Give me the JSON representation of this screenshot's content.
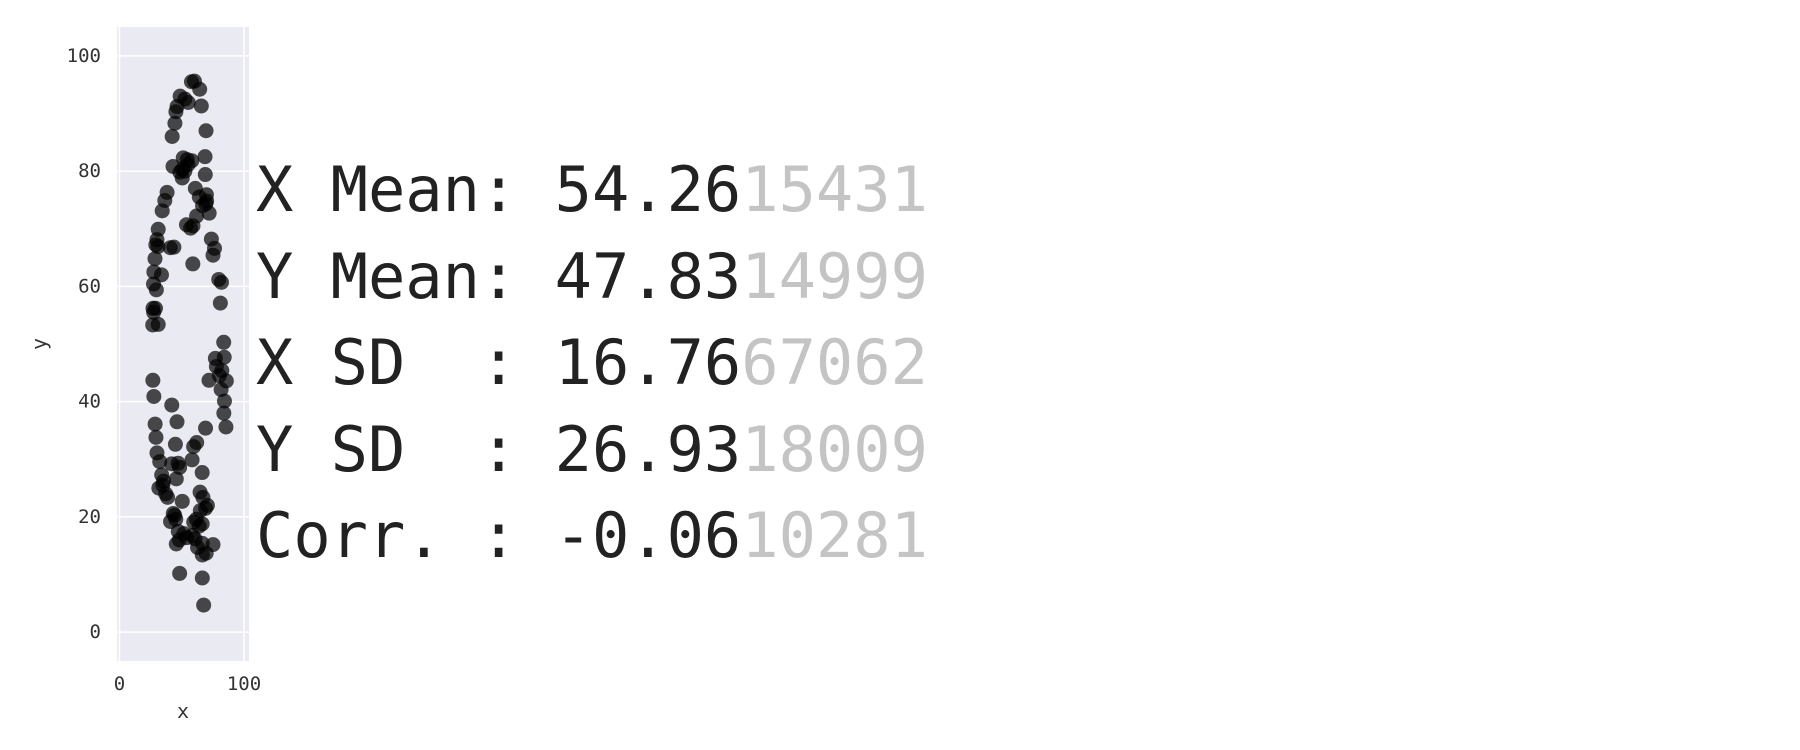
{
  "chart_data": {
    "type": "scatter",
    "xlabel": "x",
    "ylabel": "y",
    "xlim": [
      -2,
      104
    ],
    "ylim": [
      -5,
      105
    ],
    "xticks": [
      "0",
      "100"
    ],
    "yticks": [
      "0",
      "20",
      "40",
      "60",
      "80",
      "100"
    ],
    "grid": true,
    "colors": {
      "plot_bg": "#eaeaf2",
      "grid": "#ffffff",
      "point": "#000000",
      "stat_main": "#222222",
      "stat_rest": "#c4c4c4"
    },
    "points": [
      [
        57.8,
        95.5
      ],
      [
        60.2,
        95.6
      ],
      [
        64.4,
        94.2
      ],
      [
        48.7,
        93.0
      ],
      [
        52.5,
        92.5
      ],
      [
        55.2,
        91.9
      ],
      [
        46.2,
        91.2
      ],
      [
        65.7,
        91.3
      ],
      [
        45.3,
        90.3
      ],
      [
        44.5,
        88.3
      ],
      [
        69.5,
        87.0
      ],
      [
        42.3,
        86.0
      ],
      [
        68.7,
        82.5
      ],
      [
        51.2,
        82.3
      ],
      [
        54.4,
        82.0
      ],
      [
        58.1,
        81.8
      ],
      [
        55.0,
        81.1
      ],
      [
        43.0,
        80.8
      ],
      [
        50.6,
        80.3
      ],
      [
        52.5,
        80.0
      ],
      [
        48.5,
        79.8
      ],
      [
        68.9,
        79.4
      ],
      [
        50.4,
        78.8
      ],
      [
        60.9,
        77.0
      ],
      [
        38.2,
        76.3
      ],
      [
        69.8,
        75.9
      ],
      [
        64.1,
        75.5
      ],
      [
        36.4,
        74.9
      ],
      [
        69.3,
        74.3
      ],
      [
        70.0,
        74.8
      ],
      [
        66.7,
        74.0
      ],
      [
        34.3,
        73.1
      ],
      [
        72.0,
        72.7
      ],
      [
        61.9,
        72.2
      ],
      [
        53.8,
        70.7
      ],
      [
        57.1,
        70.1
      ],
      [
        59.0,
        70.5
      ],
      [
        31.1,
        69.9
      ],
      [
        30.1,
        68.1
      ],
      [
        73.8,
        68.2
      ],
      [
        29.2,
        67.2
      ],
      [
        30.9,
        66.9
      ],
      [
        40.8,
        66.7
      ],
      [
        43.7,
        66.8
      ],
      [
        76.3,
        66.6
      ],
      [
        75.1,
        65.4
      ],
      [
        28.5,
        64.8
      ],
      [
        58.9,
        63.9
      ],
      [
        27.6,
        62.5
      ],
      [
        33.7,
        62.0
      ],
      [
        79.7,
        61.2
      ],
      [
        27.3,
        60.4
      ],
      [
        81.9,
        60.7
      ],
      [
        29.6,
        59.4
      ],
      [
        81.0,
        57.1
      ],
      [
        26.9,
        56.2
      ],
      [
        27.4,
        55.5
      ],
      [
        28.9,
        56.2
      ],
      [
        26.7,
        53.3
      ],
      [
        31.1,
        53.4
      ],
      [
        83.7,
        50.3
      ],
      [
        77.0,
        47.5
      ],
      [
        84.1,
        47.7
      ],
      [
        77.8,
        46.1
      ],
      [
        82.2,
        45.4
      ],
      [
        80.2,
        44.5
      ],
      [
        71.9,
        43.7
      ],
      [
        85.8,
        43.6
      ],
      [
        26.8,
        43.7
      ],
      [
        81.6,
        42.1
      ],
      [
        27.6,
        40.9
      ],
      [
        84.3,
        40.1
      ],
      [
        42.0,
        39.4
      ],
      [
        83.8,
        38.0
      ],
      [
        46.2,
        36.5
      ],
      [
        28.6,
        36.1
      ],
      [
        85.5,
        35.6
      ],
      [
        69.1,
        35.4
      ],
      [
        29.3,
        33.8
      ],
      [
        62.0,
        32.9
      ],
      [
        44.9,
        32.6
      ],
      [
        59.5,
        32.2
      ],
      [
        30.1,
        31.1
      ],
      [
        32.3,
        29.6
      ],
      [
        58.3,
        29.9
      ],
      [
        41.9,
        29.2
      ],
      [
        47.1,
        29.3
      ],
      [
        48.3,
        28.6
      ],
      [
        66.4,
        27.7
      ],
      [
        33.9,
        27.3
      ],
      [
        35.4,
        26.2
      ],
      [
        45.6,
        26.6
      ],
      [
        31.6,
        25.0
      ],
      [
        34.8,
        25.5
      ],
      [
        37.1,
        24.0
      ],
      [
        64.7,
        24.3
      ],
      [
        38.6,
        23.4
      ],
      [
        67.0,
        23.4
      ],
      [
        50.4,
        22.7
      ],
      [
        70.6,
        22.0
      ],
      [
        69.1,
        21.5
      ],
      [
        64.9,
        21.1
      ],
      [
        43.2,
        20.6
      ],
      [
        44.3,
        20.3
      ],
      [
        41.0,
        19.2
      ],
      [
        45.2,
        19.6
      ],
      [
        61.7,
        19.6
      ],
      [
        59.6,
        19.1
      ],
      [
        64.0,
        18.4
      ],
      [
        66.4,
        18.8
      ],
      [
        47.2,
        17.5
      ],
      [
        51.8,
        17.1
      ],
      [
        58.6,
        16.8
      ],
      [
        60.6,
        16.2
      ],
      [
        48.1,
        16.0
      ],
      [
        53.9,
        16.4
      ],
      [
        66.5,
        15.4
      ],
      [
        45.6,
        15.3
      ],
      [
        62.7,
        14.7
      ],
      [
        75.1,
        15.2
      ],
      [
        69.6,
        13.7
      ],
      [
        66.5,
        13.4
      ],
      [
        48.3,
        10.2
      ],
      [
        66.5,
        9.4
      ],
      [
        67.6,
        4.7
      ]
    ],
    "stats": [
      {
        "label": "X Mean: ",
        "main": "54.26",
        "rest": "15431"
      },
      {
        "label": "Y Mean: ",
        "main": "47.83",
        "rest": "14999"
      },
      {
        "label": "X SD  : ",
        "main": "16.76",
        "rest": "67062"
      },
      {
        "label": "Y SD  : ",
        "main": "26.93",
        "rest": "18009"
      },
      {
        "label": "Corr. : ",
        "main": "-0.06",
        "rest": "10281"
      }
    ]
  }
}
